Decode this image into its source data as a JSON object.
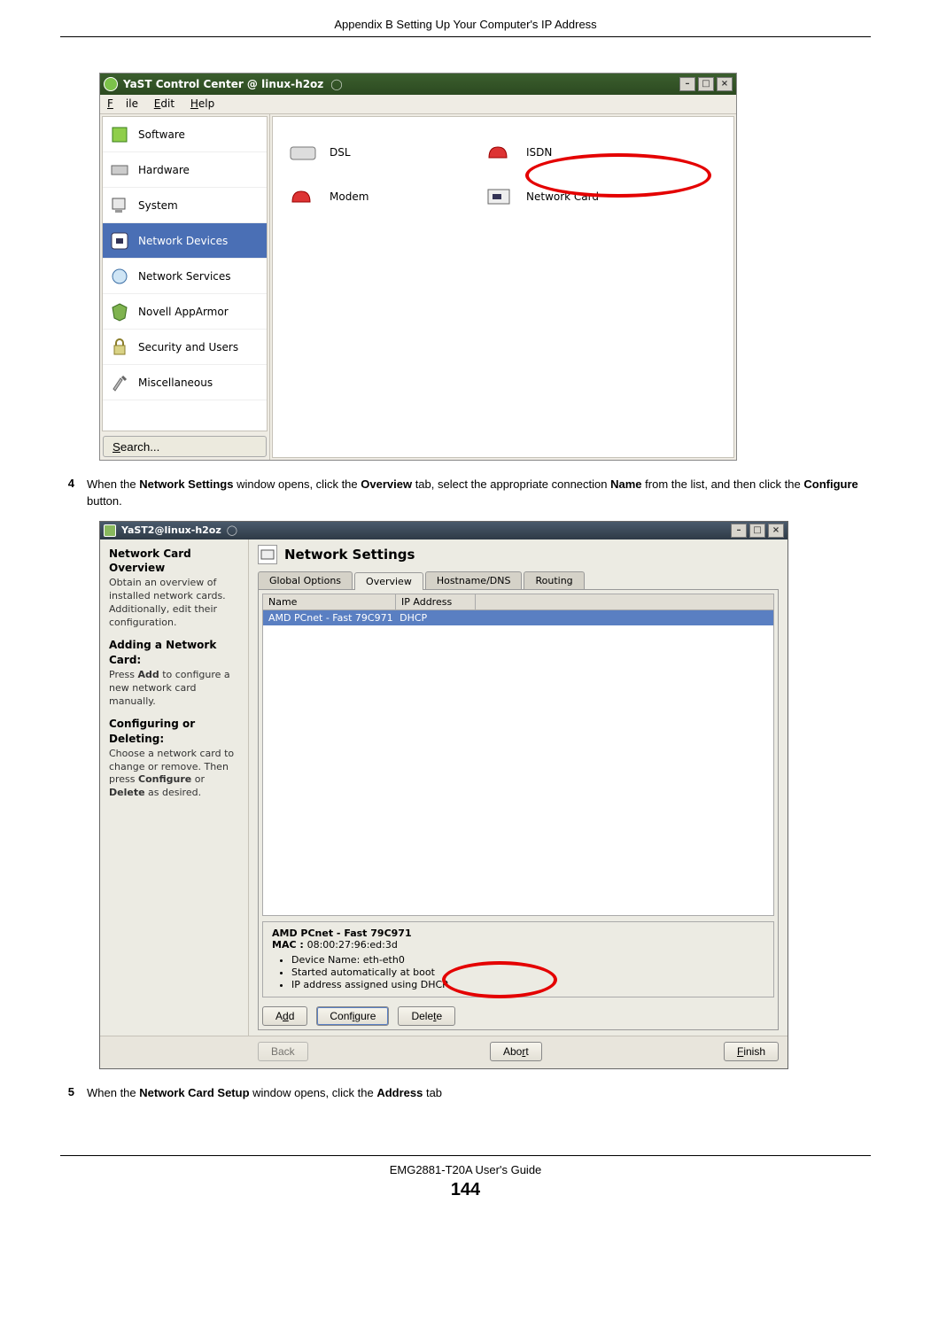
{
  "doc": {
    "appendix_header": "Appendix B Setting Up Your Computer's IP Address",
    "footer_title": "EMG2881-T20A User's Guide",
    "page_number": "144",
    "step4": {
      "num": "4",
      "t1": "When the ",
      "b1": "Network Settings",
      "t2": " window opens, click the ",
      "b2": "Overview",
      "t3": " tab, select the appropriate connection ",
      "b3": "Name",
      "t4": " from the list, and then click the ",
      "b4": "Configure",
      "t5": " button."
    },
    "step5": {
      "num": "5",
      "t1": "When the ",
      "b1": "Network Card Setup",
      "t2": " window opens, click the ",
      "b2": "Address",
      "t3": " tab"
    }
  },
  "shot1": {
    "title": "YaST Control Center @ linux-h2oz",
    "menu": {
      "file": "File",
      "edit": "Edit",
      "help": "Help"
    },
    "sidebar": [
      "Software",
      "Hardware",
      "System",
      "Network Devices",
      "Network Services",
      "Novell AppArmor",
      "Security and Users",
      "Miscellaneous"
    ],
    "search": "Search...",
    "items": {
      "dsl": "DSL",
      "isdn": "ISDN",
      "modem": "Modem",
      "netcard": "Network Card"
    }
  },
  "shot2": {
    "title": "YaST2@linux-h2oz",
    "help": {
      "h1": "Network Card Overview",
      "p1": "Obtain an overview of installed network cards. Additionally, edit their configuration.",
      "h2": "Adding a Network Card:",
      "p2_a": "Press ",
      "p2_b": "Add",
      "p2_c": " to configure a new network card manually.",
      "h3": "Configuring or Deleting:",
      "p3_a": "Choose a network card to change or remove. Then press ",
      "p3_b": "Configure",
      "p3_c": " or ",
      "p3_d": "Delete",
      "p3_e": " as desired."
    },
    "heading": "Network Settings",
    "tabs": {
      "global": "Global Options",
      "overview": "Overview",
      "hostname": "Hostname/DNS",
      "routing": "Routing"
    },
    "grid": {
      "col_name": "Name",
      "col_ip": "IP Address",
      "row_name": "AMD PCnet - Fast 79C971",
      "row_ip": "DHCP"
    },
    "detail": {
      "name": "AMD PCnet - Fast 79C971",
      "mac_label": "MAC : ",
      "mac": "08:00:27:96:ed:3d",
      "b1": "Device Name: eth-eth0",
      "b2": "Started automatically at boot",
      "b3": "IP address assigned using DHCP"
    },
    "buttons": {
      "add": "Add",
      "configure": "Configure",
      "delete": "Delete",
      "back": "Back",
      "abort": "Abort",
      "finish": "Finish"
    }
  }
}
